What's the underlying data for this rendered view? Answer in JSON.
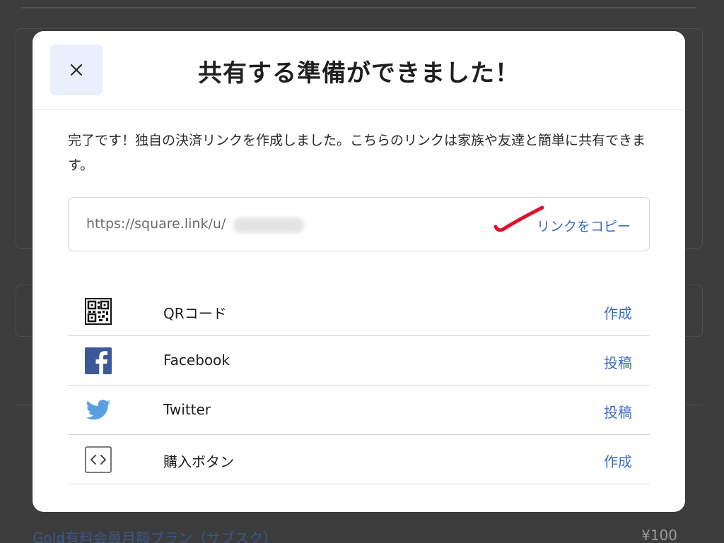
{
  "modal": {
    "title": "共有する準備ができました！",
    "description": "完了です！独自の決済リンクを作成しました。こちらのリンクは家族や友達と簡単に共有できます。",
    "link": {
      "url": "https://square.link/u/",
      "copy_label": "リンクをコピー"
    },
    "share_options": [
      {
        "icon": "qr-code-icon",
        "label": "QRコード",
        "action": "作成"
      },
      {
        "icon": "facebook-icon",
        "label": "Facebook",
        "action": "投稿"
      },
      {
        "icon": "twitter-icon",
        "label": "Twitter",
        "action": "投稿"
      },
      {
        "icon": "code-icon",
        "label": "購入ボタン",
        "action": "作成"
      }
    ]
  },
  "background": {
    "plan_name": "Gold有料会員月額プラン（サブスク）",
    "price": "¥100"
  },
  "colors": {
    "accent": "#3b6cc0",
    "close_button_bg": "#e9f0fc",
    "facebook": "#3b5998",
    "twitter": "#5aa0e0",
    "annotation": "#e0102a",
    "overlay": "#3c3c3c"
  }
}
